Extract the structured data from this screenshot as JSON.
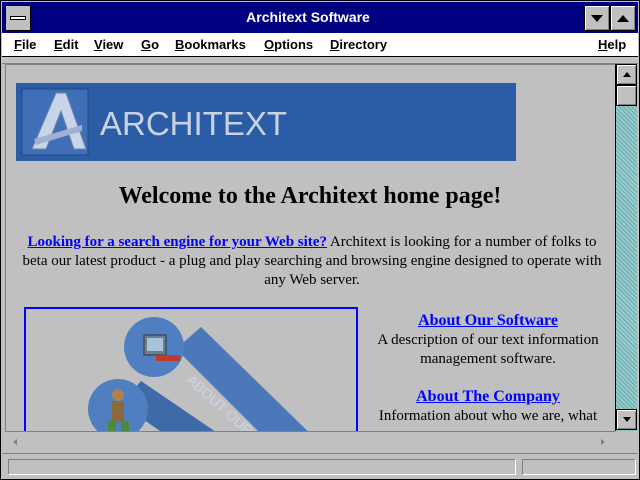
{
  "window": {
    "title": "Architext Software"
  },
  "menu": [
    {
      "label": "File",
      "key": "F",
      "rest": "ile"
    },
    {
      "label": "Edit",
      "key": "E",
      "rest": "dit"
    },
    {
      "label": "View",
      "key": "V",
      "rest": "iew"
    },
    {
      "label": "Go",
      "key": "G",
      "rest": "o"
    },
    {
      "label": "Bookmarks",
      "key": "B",
      "rest": "ookmarks"
    },
    {
      "label": "Options",
      "key": "O",
      "rest": "ptions"
    },
    {
      "label": "Directory",
      "key": "D",
      "rest": "irectory"
    },
    {
      "label": "Help",
      "key": "H",
      "rest": "elp"
    }
  ],
  "banner": {
    "text": "ARCHITEXT",
    "logo_letter": "A",
    "bg_color": "#2b5da6"
  },
  "page": {
    "heading": "Welcome to the Architext home page!",
    "intro_link": "Looking for a search engine for your Web site?",
    "intro_text": " Architext is looking for a number of folks to beta our latest product - a plug and play searching and browsing engine designed to operate with any Web server.",
    "image_caption": "ABOUT OUR"
  },
  "sidebar": [
    {
      "link": "About Our Software",
      "desc": "A description of our text information management software."
    },
    {
      "link": "About The Company",
      "desc": "Information about who we are, what"
    }
  ],
  "colors": {
    "titlebar": "#000080",
    "link": "#0000ff",
    "chrome": "#c0c0c0"
  }
}
